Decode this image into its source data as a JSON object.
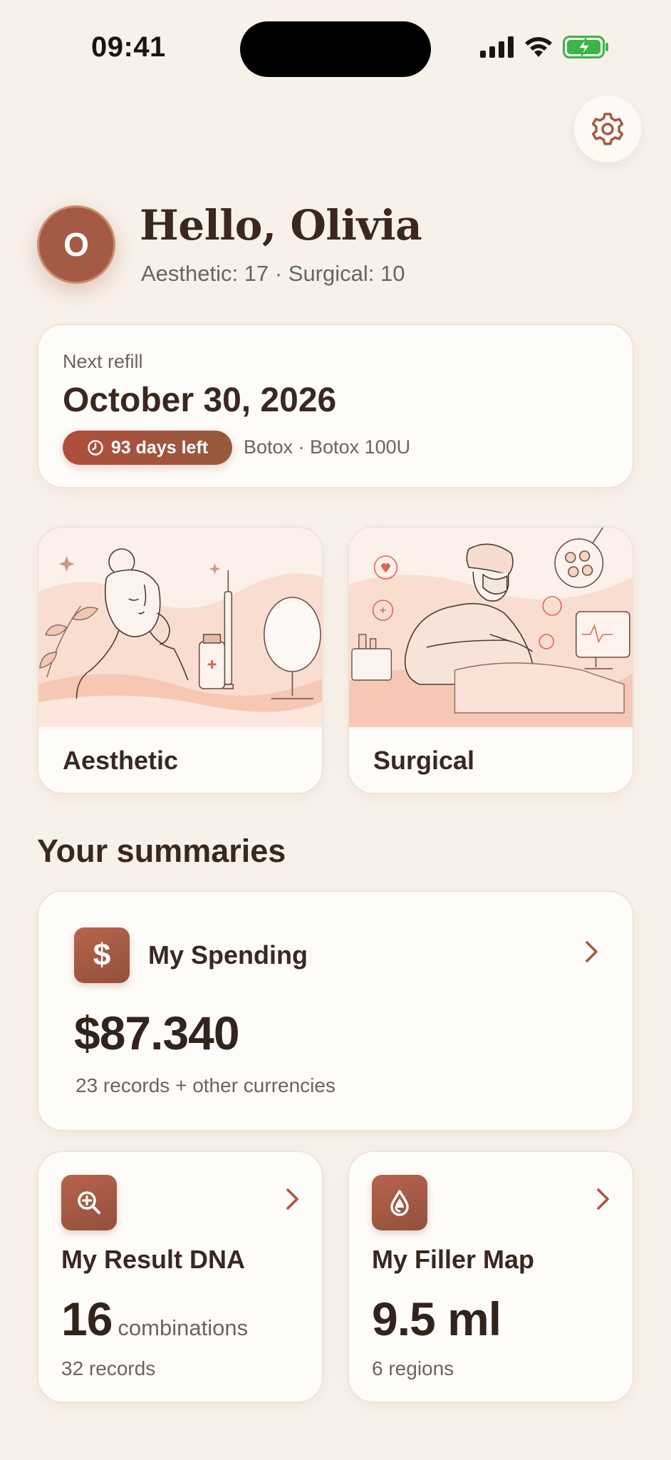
{
  "status_bar": {
    "time": "09:41"
  },
  "greeting": {
    "avatar_initial": "O",
    "title": "Hello, Olivia",
    "counts": "Aesthetic: 17 · Surgical: 10"
  },
  "refill": {
    "label": "Next refill",
    "date": "October 30, 2026",
    "days_left": "93 days left",
    "meta": "Botox · Botox 100U"
  },
  "categories": [
    {
      "label": "Aesthetic"
    },
    {
      "label": "Surgical"
    }
  ],
  "summaries": {
    "title": "Your summaries",
    "spending": {
      "title": "My Spending",
      "icon": "$",
      "amount": "$87.340",
      "sub": "23 records + other currencies"
    },
    "dna": {
      "title": "My Result DNA",
      "value": "16",
      "unit": "combinations",
      "sub": "32 records"
    },
    "filler": {
      "title": "My Filler Map",
      "value": "9.5 ml",
      "sub": "6 regions"
    }
  },
  "colors": {
    "background": "#f8f1ea",
    "accent": "#a45a44",
    "text_primary": "#3a2820",
    "text_secondary": "#6f625c"
  }
}
